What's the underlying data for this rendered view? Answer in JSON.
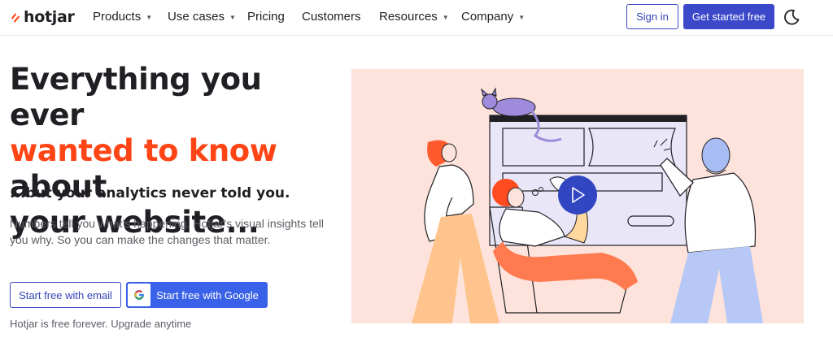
{
  "brand": {
    "name": "hotjar"
  },
  "nav": {
    "items": [
      {
        "label": "Products",
        "dropdown": true
      },
      {
        "label": "Use cases",
        "dropdown": true
      },
      {
        "label": "Pricing",
        "dropdown": false
      },
      {
        "label": "Customers",
        "dropdown": false
      },
      {
        "label": "Resources",
        "dropdown": true
      },
      {
        "label": "Company",
        "dropdown": true
      }
    ],
    "signin_label": "Sign in",
    "get_started_label": "Get started free"
  },
  "hero": {
    "headline_line1": "Everything you ever",
    "headline_accent": "wanted to know",
    "headline_after_accent": " about",
    "headline_line3": "your website...",
    "subheadline": "...but your analytics never told you.",
    "description": "Numbers tell you what’s happening. Hotjar’s visual insights tell you why. So you can make the changes that matter.",
    "email_button_label": "Start free with email",
    "google_button_label": "Start free with Google",
    "free_note": "Hotjar is free forever. Upgrade anytime"
  },
  "colors": {
    "accent_orange": "#ff4515",
    "primary_blue": "#3a48c9",
    "google_blue": "#3a62e8",
    "illustration_bg": "#fde3db"
  },
  "icons": {
    "logo": "hotjar-flame-icon",
    "theme_toggle": "moon-icon",
    "google": "google-g-icon",
    "video": "play-icon"
  }
}
